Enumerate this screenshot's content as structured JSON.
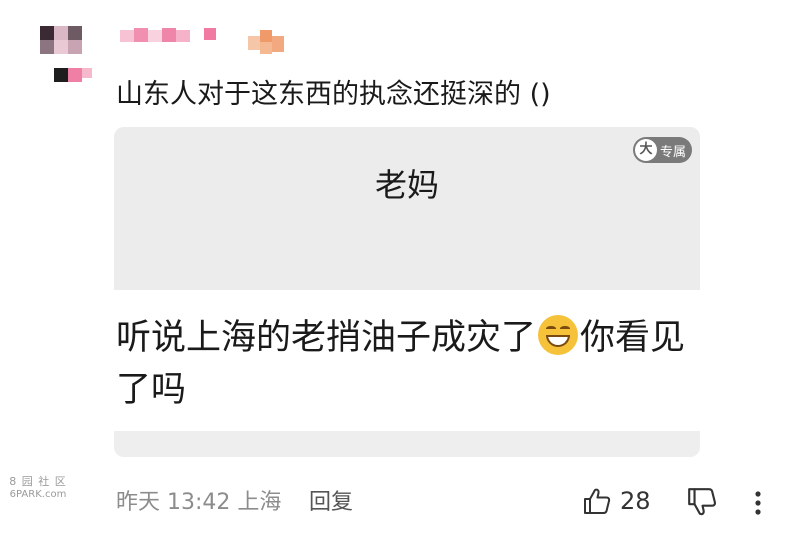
{
  "comment": {
    "text": "山东人对于这东西的执念还挺深的 ()"
  },
  "card": {
    "title": "老妈",
    "badge_icon_text": "大",
    "badge_text": "专属",
    "body_before_emoji": "听说上海的老捎油子成灾了",
    "emoji": "grinning-face",
    "body_after_emoji": "你看见了吗"
  },
  "watermark": {
    "top": "8 园 社 区",
    "bottom": "6PARK.com"
  },
  "footer": {
    "meta": "昨天 13:42 上海",
    "reply_label": "回复",
    "like_count": "28"
  },
  "colors": {
    "card_background": "#efefef",
    "badge_background": "#7a7a7a",
    "meta_text": "#8c8c8c"
  }
}
